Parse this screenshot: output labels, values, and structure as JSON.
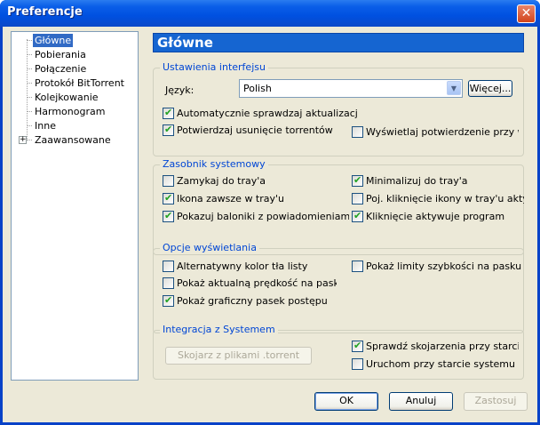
{
  "window": {
    "title": "Preferencje",
    "close_glyph": "✕"
  },
  "tree": {
    "items": [
      "Główne",
      "Pobierania",
      "Połączenie",
      "Protokół BitTorrent",
      "Kolejkowanie",
      "Harmonogram",
      "Inne",
      "Zaawansowane"
    ],
    "selected": "Główne",
    "expander_glyph": "+"
  },
  "page_title": "Główne",
  "interface_group": {
    "title": "Ustawienia interfejsu",
    "language_label": "Język:",
    "language_value": "Polish",
    "more_button": "Więcej...",
    "check_updates": {
      "label": "Automatycznie sprawdzaj aktualizacje",
      "checked": true
    },
    "confirm_delete": {
      "label": "Potwierdzaj usunięcie torrentów",
      "checked": true
    },
    "show_confirm_exit": {
      "label": "Wyświetlaj potwierdzenie przy wyjściu",
      "checked": false
    }
  },
  "tray_group": {
    "title": "Zasobnik systemowy",
    "close_to_tray": {
      "label": "Zamykaj do tray'a",
      "checked": false
    },
    "minimize_to_tray": {
      "label": "Minimalizuj do tray'a",
      "checked": true
    },
    "always_icon": {
      "label": "Ikona zawsze w tray'u",
      "checked": true
    },
    "single_click": {
      "label": "Poj. kliknięcie ikony w tray'u aktywuje",
      "checked": false
    },
    "show_balloons": {
      "label": "Pokazuj baloniki z powiadomieniami w tray'u",
      "checked": true
    },
    "click_activates": {
      "label": "Kliknięcie aktywuje program",
      "checked": true
    }
  },
  "display_group": {
    "title": "Opcje wyświetlania",
    "alt_color": {
      "label": "Alternatywny kolor tła listy",
      "checked": false
    },
    "show_limits": {
      "label": "Pokaż limity szybkości na pasku statusu",
      "checked": false
    },
    "show_speed": {
      "label": "Pokaż aktualną prędkość na pasku tytułu",
      "checked": false
    },
    "graphic_bar": {
      "label": "Pokaż graficzny pasek postępu",
      "checked": true
    }
  },
  "system_group": {
    "title": "Integracja z Systemem",
    "associate_button": "Skojarz z plikami .torrent",
    "check_assoc": {
      "label": "Sprawdź skojarzenia przy starcie",
      "checked": true
    },
    "run_on_start": {
      "label": "Uruchom przy starcie systemu",
      "checked": false
    }
  },
  "buttons": {
    "ok": "OK",
    "cancel": "Anuluj",
    "apply": "Zastosuj"
  }
}
